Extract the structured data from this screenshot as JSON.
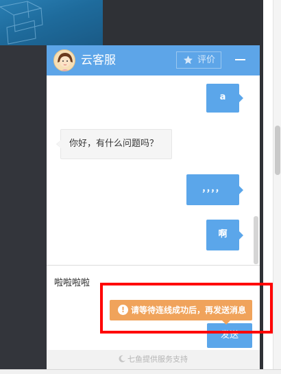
{
  "header": {
    "title": "云客服",
    "rate_label": "评价"
  },
  "messages": [
    {
      "side": "right",
      "text": "a"
    },
    {
      "side": "left",
      "text": "你好，有什么问题吗？"
    },
    {
      "side": "right",
      "text": "，，，，"
    },
    {
      "side": "right",
      "text": "啊"
    }
  ],
  "input": {
    "value": "啦啦啦啦",
    "send_label": "发送"
  },
  "toast": {
    "icon": "!",
    "text": "请等待连线成功后，再发送消息"
  },
  "footer": {
    "text": "七鱼提供服务支持"
  },
  "colors": {
    "header": "#5da5e8",
    "bubble": "#5ba6ea",
    "toast": "#f0a35b",
    "highlight": "#ff0000"
  }
}
